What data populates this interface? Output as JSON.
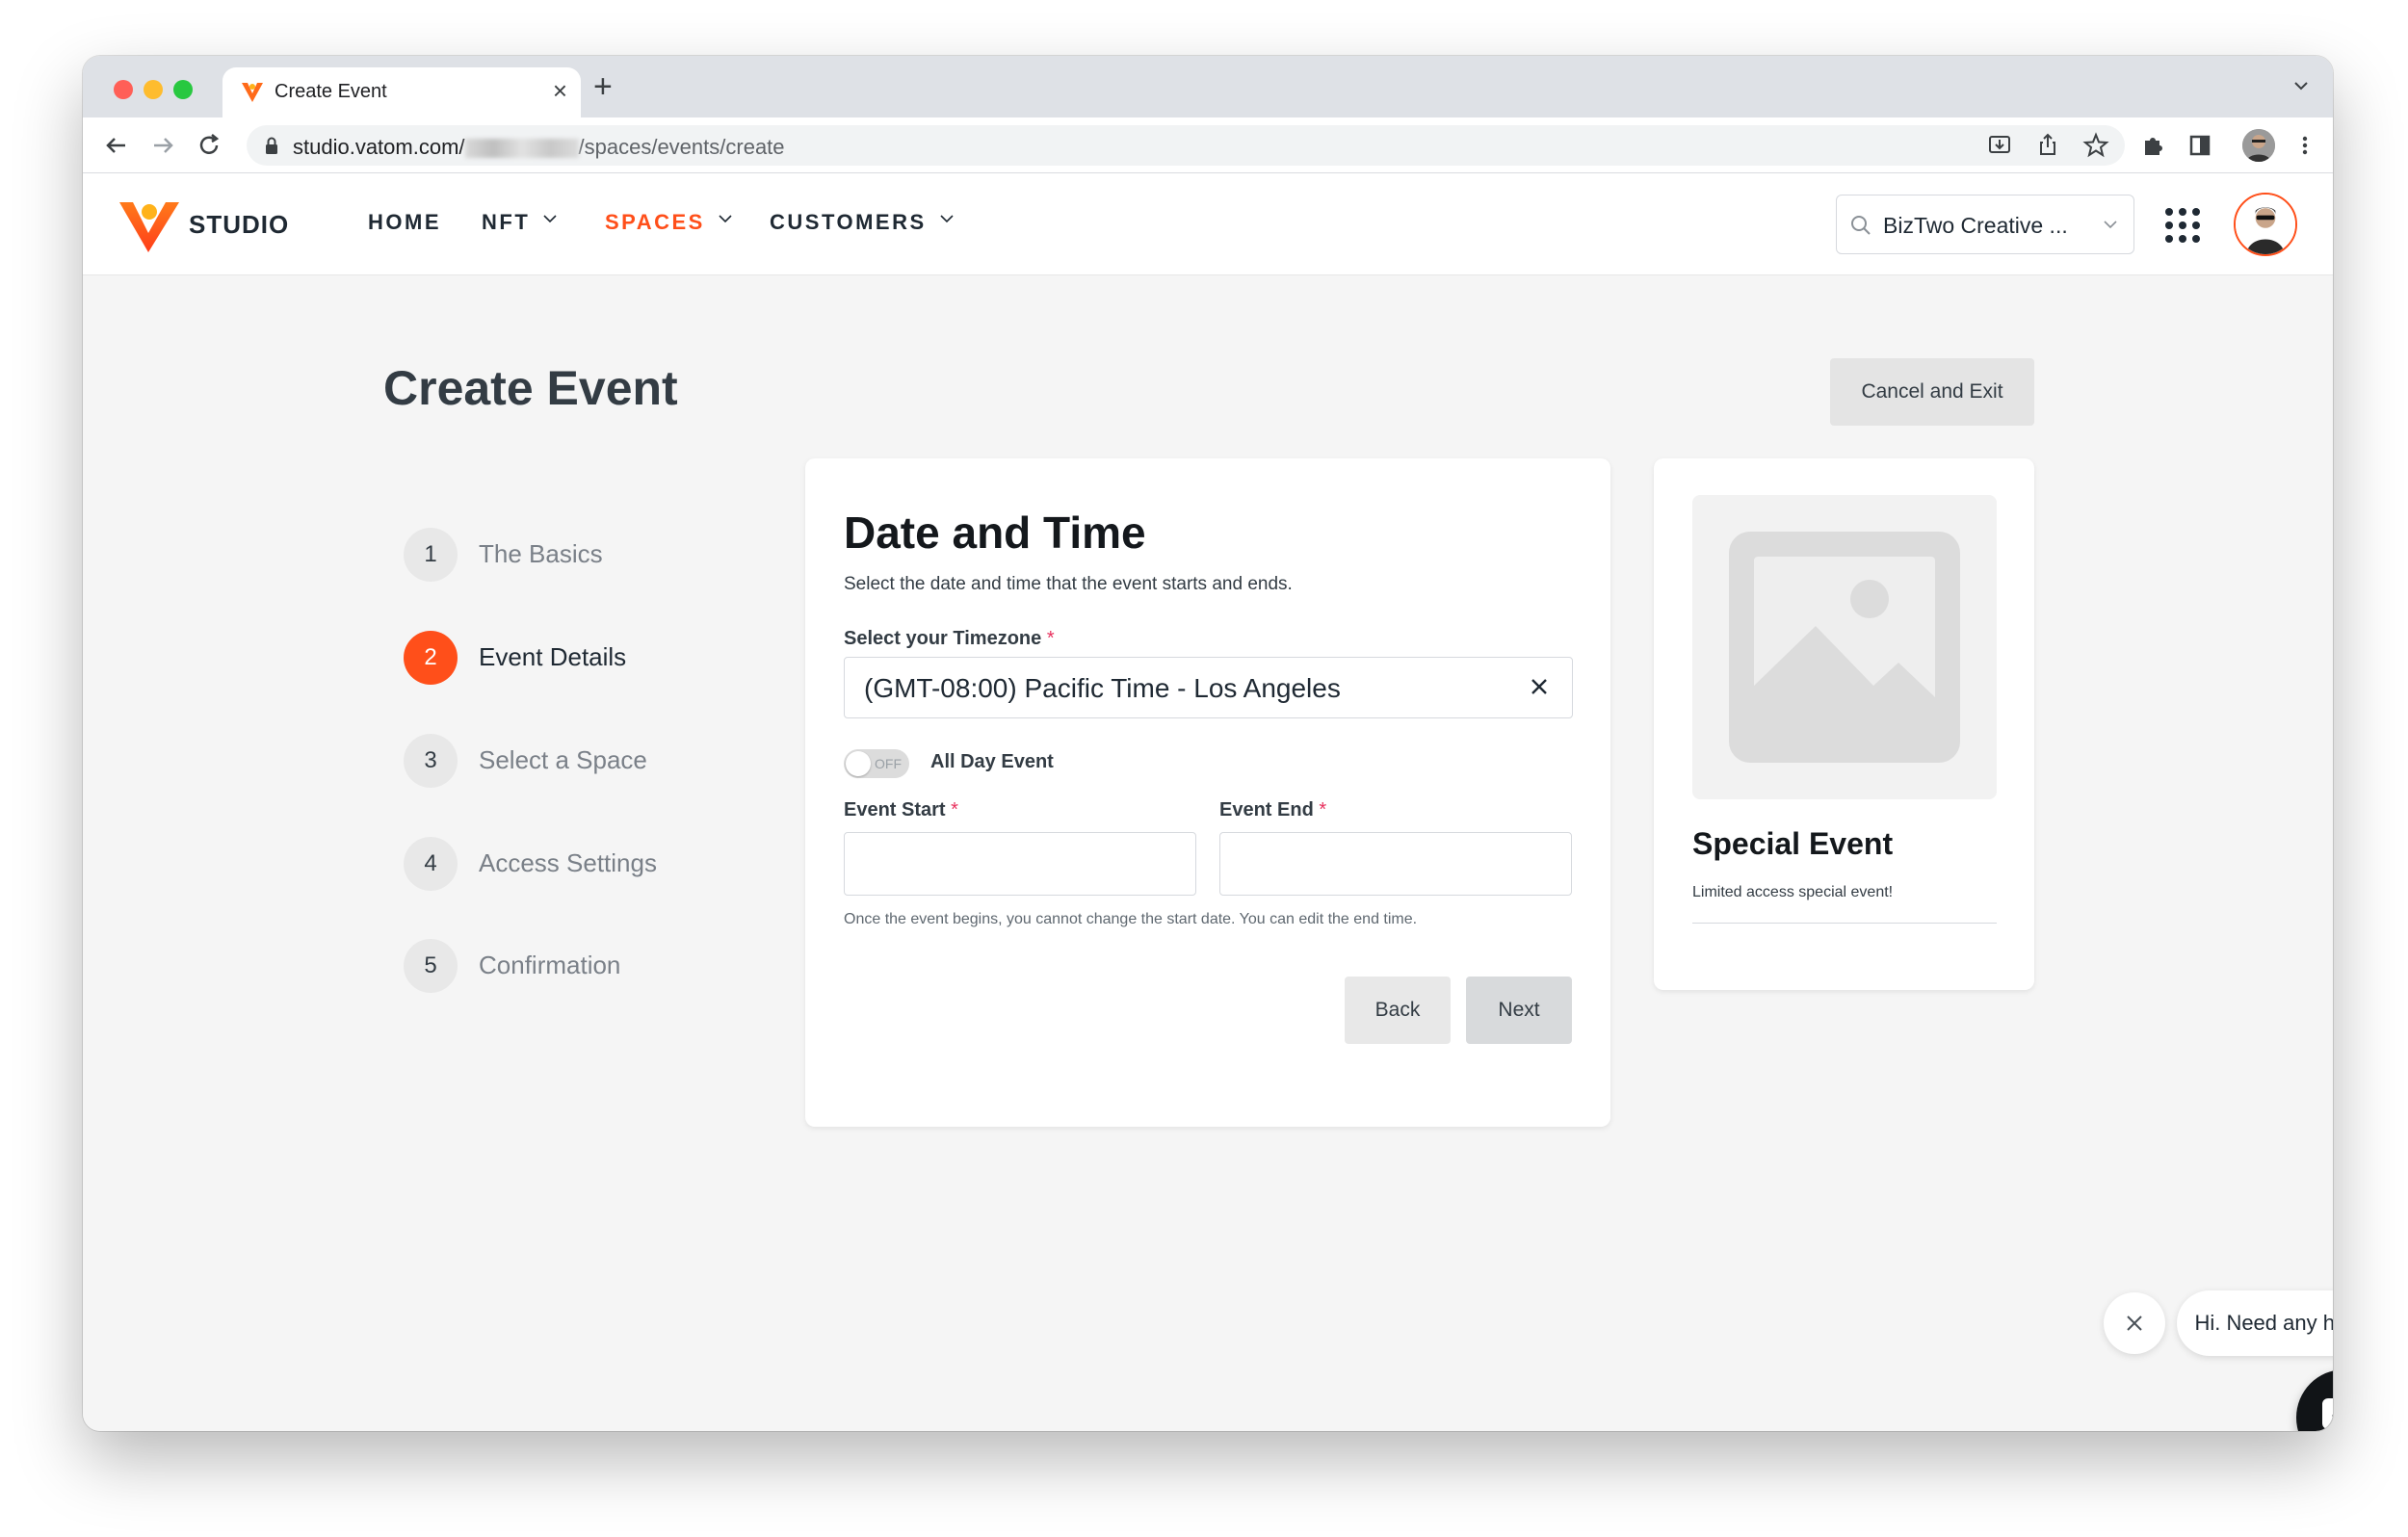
{
  "browser": {
    "tab_title": "Create Event",
    "url_host": "studio.vatom.com/",
    "url_path": "/spaces/events/create"
  },
  "app": {
    "logo_text": "STUDIO",
    "nav": [
      {
        "label": "HOME"
      },
      {
        "label": "NFT"
      },
      {
        "label": "SPACES"
      },
      {
        "label": "CUSTOMERS"
      }
    ],
    "org_selector": "BizTwo Creative ...",
    "accent_color": "#ff4f1a"
  },
  "page": {
    "title": "Create Event",
    "cancel_label": "Cancel and Exit"
  },
  "steps": [
    {
      "num": "1",
      "label": "The Basics"
    },
    {
      "num": "2",
      "label": "Event Details"
    },
    {
      "num": "3",
      "label": "Select a Space"
    },
    {
      "num": "4",
      "label": "Access Settings"
    },
    {
      "num": "5",
      "label": "Confirmation"
    }
  ],
  "form": {
    "title": "Date and Time",
    "subtitle": "Select the date and time that the event starts and ends.",
    "timezone_label": "Select your Timezone",
    "timezone_value": "(GMT-08:00) Pacific Time - Los Angeles",
    "required_mark": "*",
    "toggle_state": "OFF",
    "all_day_label": "All Day Event",
    "start_label": "Event Start",
    "end_label": "Event End",
    "start_value": "",
    "end_value": "",
    "hint": "Once the event begins, you cannot change the start date. You can edit the end time.",
    "back_label": "Back",
    "next_label": "Next"
  },
  "preview": {
    "title": "Special Event",
    "description": "Limited access special event!"
  },
  "help": {
    "message": "Hi. Need any help?"
  }
}
